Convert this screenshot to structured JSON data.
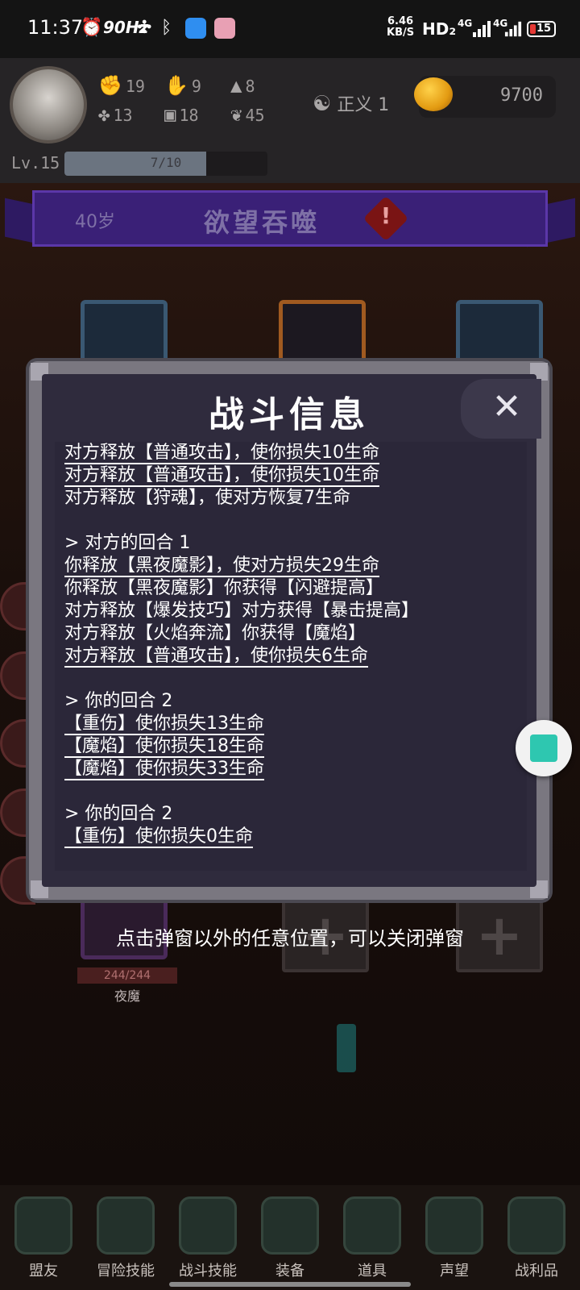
{
  "status_bar": {
    "time": "11:37",
    "refresh_rate": "90Hz",
    "net_speed_value": "6.46",
    "net_speed_unit": "KB/S",
    "hd_label": "HD₂",
    "signal_1": "4G",
    "signal_2": "4G",
    "battery": "15",
    "icons": [
      "alarm-icon",
      "fan-icon",
      "bluetooth-icon",
      "app-icon",
      "app-icon"
    ]
  },
  "player": {
    "stats": [
      {
        "icon": "fist-icon",
        "value": "19"
      },
      {
        "icon": "hand-icon",
        "value": "9"
      },
      {
        "icon": "wizard-hat-icon",
        "value": "8"
      },
      {
        "icon": "clover-icon",
        "value": "13"
      },
      {
        "icon": "armor-icon",
        "value": "18"
      },
      {
        "icon": "lotus-icon",
        "value": "45"
      }
    ],
    "justice_label": "正义 1",
    "gold": "9700",
    "level": "Lv.15",
    "xp_text": "7/10",
    "xp_fraction": 0.7
  },
  "scene": {
    "age": "40岁",
    "event_title": "欲望吞噬",
    "enemy_hp": "244/244",
    "enemy_name": "夜魔"
  },
  "modal": {
    "title": "战斗信息",
    "close_symbol": "✕",
    "lines": [
      {
        "text": "对方释放【普通攻击】，使你损失10生命",
        "u": true
      },
      {
        "text": "对方释放【普通攻击】，使你损失10生命",
        "u": true
      },
      {
        "text": "对方释放【狩魂】，使对方恢复7生命",
        "u": false
      },
      {
        "text": "",
        "u": false
      },
      {
        "text": "> 对方的回合 1",
        "u": false
      },
      {
        "text": "你释放【黑夜魔影】，使对方损失29生命",
        "u": true
      },
      {
        "text": "你释放【黑夜魔影】你获得【闪避提高】",
        "u": false
      },
      {
        "text": "对方释放【爆发技巧】对方获得【暴击提高】",
        "u": false
      },
      {
        "text": "对方释放【火焰奔流】你获得【魔焰】",
        "u": false
      },
      {
        "text": "对方释放【普通攻击】，使你损失6生命",
        "u": true
      },
      {
        "text": "",
        "u": false
      },
      {
        "text": "> 你的回合 2",
        "u": false
      },
      {
        "text": "【重伤】使你损失13生命",
        "u": true
      },
      {
        "text": "【魔焰】使你损失18生命",
        "u": true
      },
      {
        "text": "【魔焰】使你损失33生命",
        "u": true
      },
      {
        "text": "",
        "u": false
      },
      {
        "text": "> 你的回合 2",
        "u": false
      },
      {
        "text": "【重伤】使你损失0生命",
        "u": true
      }
    ],
    "hint": "点击弹窗以外的任意位置，可以关闭弹窗"
  },
  "bottom_nav": [
    {
      "label": "盟友",
      "icon": "gloves-icon"
    },
    {
      "label": "冒险技能",
      "icon": "book-icon"
    },
    {
      "label": "战斗技能",
      "icon": "backpack-icon"
    },
    {
      "label": "装备",
      "icon": "swords-icon"
    },
    {
      "label": "道具",
      "icon": "bag-icon"
    },
    {
      "label": "声望",
      "icon": "scroll-icon"
    },
    {
      "label": "战利品",
      "icon": "chest-icon"
    }
  ]
}
